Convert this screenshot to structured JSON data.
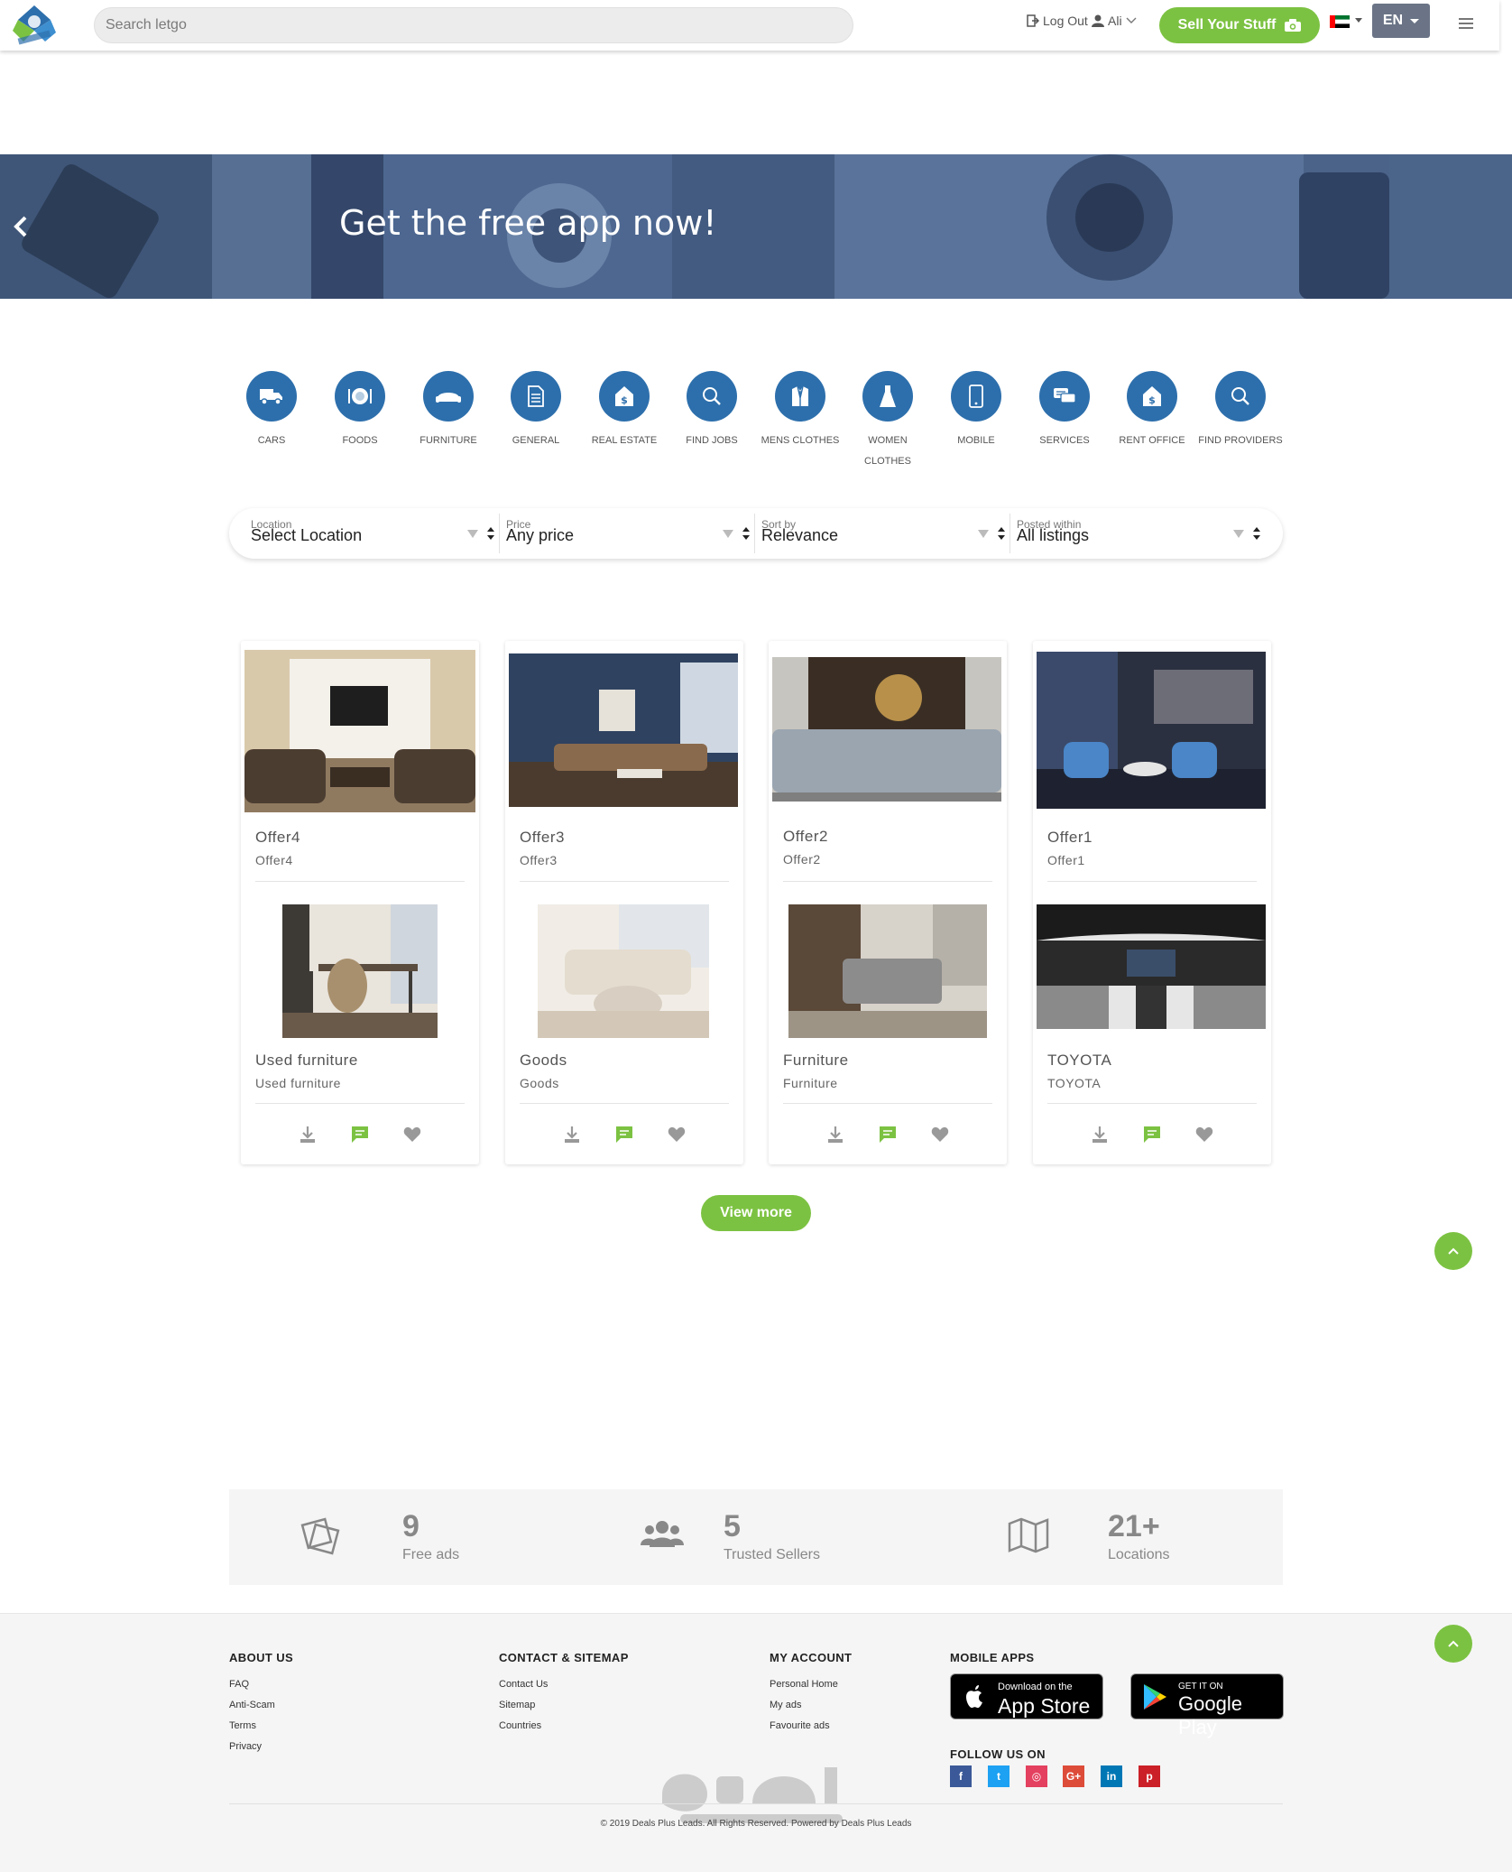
{
  "header": {
    "search_placeholder": "Search letgo",
    "logout_label": "Log Out",
    "user_name": "Ali",
    "sell_label": "Sell Your Stuff",
    "language": "EN",
    "accent": "#7cc242"
  },
  "banner": {
    "title": "Get the free app now!"
  },
  "categories": [
    {
      "label": "CARS",
      "icon": "truck-icon"
    },
    {
      "label": "FOODS",
      "icon": "plate-icon"
    },
    {
      "label": "FURNITURE",
      "icon": "sofa-icon"
    },
    {
      "label": "GENERAL",
      "icon": "document-icon"
    },
    {
      "label": "REAL ESTATE",
      "icon": "house-dollar-icon"
    },
    {
      "label": "FIND JOBS",
      "icon": "search-icon"
    },
    {
      "label": "MENS CLOTHES",
      "icon": "suit-icon"
    },
    {
      "label": "WOMEN CLOTHES",
      "icon": "dress-icon"
    },
    {
      "label": "MOBILE",
      "icon": "phone-icon"
    },
    {
      "label": "SERVICES",
      "icon": "chat-icon"
    },
    {
      "label": "RENT OFFICE",
      "icon": "house-dollar-icon"
    },
    {
      "label": "FIND PROVIDERS",
      "icon": "search-icon"
    }
  ],
  "filters": [
    {
      "label": "Location",
      "value": "Select Location"
    },
    {
      "label": "Price",
      "value": "Any price"
    },
    {
      "label": "Sort by",
      "value": "Relevance"
    },
    {
      "label": "Posted within",
      "value": "All listings"
    }
  ],
  "listings": [
    {
      "offer": {
        "title": "Offer4",
        "subtitle": "Offer4"
      },
      "item": {
        "title": "Used furniture",
        "subtitle": "Used furniture"
      }
    },
    {
      "offer": {
        "title": "Offer3",
        "subtitle": "Offer3"
      },
      "item": {
        "title": "Goods",
        "subtitle": "Goods"
      }
    },
    {
      "offer": {
        "title": "Offer2",
        "subtitle": "Offer2"
      },
      "item": {
        "title": "Furniture",
        "subtitle": "Furniture"
      }
    },
    {
      "offer": {
        "title": "Offer1",
        "subtitle": "Offer1"
      },
      "item": {
        "title": "TOYOTA",
        "subtitle": "TOYOTA"
      }
    }
  ],
  "view_more_label": "View more",
  "stats": [
    {
      "number": "9",
      "label": "Free ads",
      "icon": "tag-icon"
    },
    {
      "number": "5",
      "label": "Trusted Sellers",
      "icon": "users-icon"
    },
    {
      "number": "21+",
      "label": "Locations",
      "icon": "map-icon"
    }
  ],
  "footer": {
    "about": {
      "heading": "ABOUT US",
      "links": [
        "FAQ",
        "Anti-Scam",
        "Terms",
        "Privacy"
      ]
    },
    "contact": {
      "heading": "CONTACT & SITEMAP",
      "links": [
        "Contact Us",
        "Sitemap",
        "Countries"
      ]
    },
    "account": {
      "heading": "MY ACCOUNT",
      "links": [
        "Personal Home",
        "My ads",
        "Favourite ads"
      ]
    },
    "apps": {
      "heading": "MOBILE APPS",
      "appstore_small": "Download on the",
      "appstore_big": "App Store",
      "googleplay_small": "GET IT ON",
      "googleplay_big": "Google Play"
    },
    "follow_heading": "FOLLOW US ON",
    "social": [
      {
        "glyph": "f",
        "color": "#3b5998",
        "icon": "facebook-icon"
      },
      {
        "glyph": "t",
        "color": "#1da1f2",
        "icon": "twitter-icon"
      },
      {
        "glyph": "◎",
        "color": "#e4405f",
        "icon": "instagram-icon"
      },
      {
        "glyph": "G+",
        "color": "#dd4b39",
        "icon": "google-plus-icon"
      },
      {
        "glyph": "in",
        "color": "#0077b5",
        "icon": "linkedin-icon"
      },
      {
        "glyph": "p",
        "color": "#cb2027",
        "icon": "pinterest-icon"
      }
    ],
    "copyright": "© 2019 Deals Plus Leads. All Rights Reserved. Powered by Deals Plus Leads"
  }
}
